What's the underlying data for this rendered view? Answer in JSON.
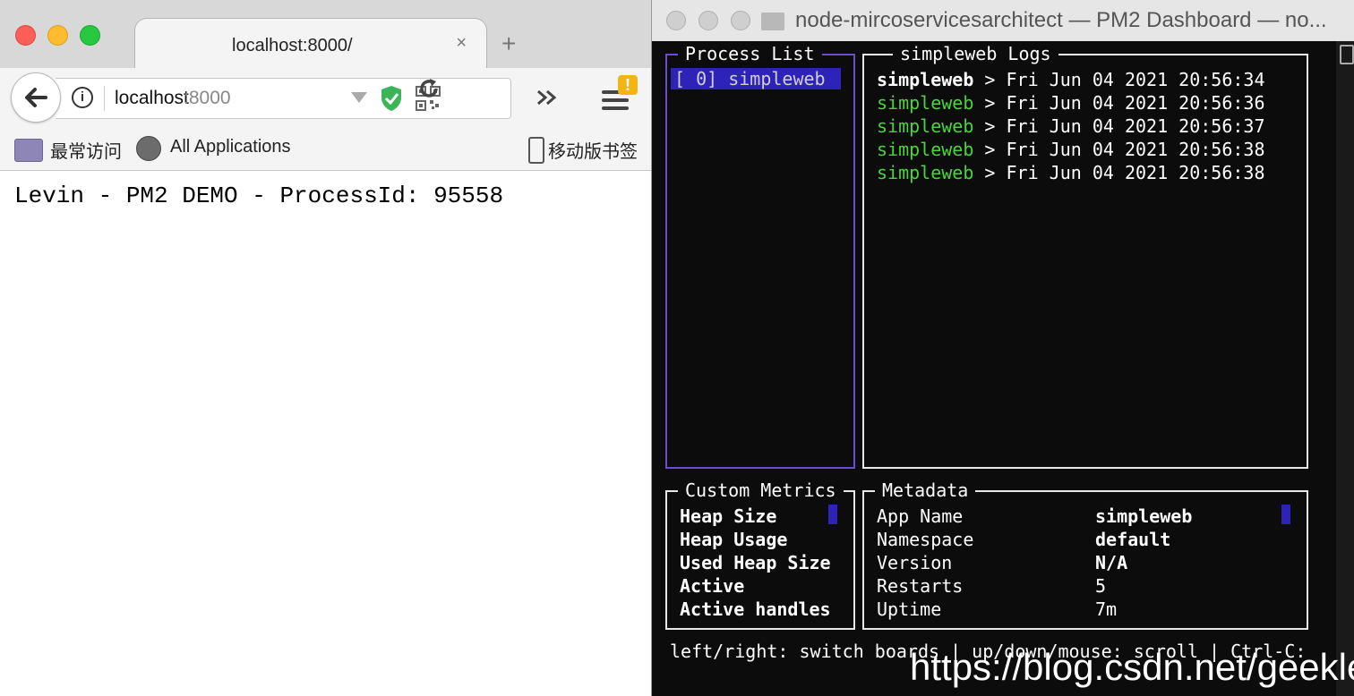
{
  "browser": {
    "tab_title": "localhost:8000/",
    "tab_close": "×",
    "new_tab": "+",
    "url_host": "localhost",
    "url_port": ":8000",
    "bookmarks": [
      "最常访问",
      "All Applications",
      "移动版书签"
    ],
    "page_text": "Levin - PM2 DEMO - ProcessId: 95558",
    "warning_badge": "!"
  },
  "terminal": {
    "window_title": "node-mircoservicesarchitect — PM2 Dashboard — no...",
    "process_list": {
      "label": "Process List",
      "items": [
        "[ 0] simpleweb"
      ]
    },
    "logs": {
      "label": "simpleweb Logs",
      "lines": [
        {
          "app": "simpleweb",
          "text": " > Fri Jun 04 2021 20:56:34"
        },
        {
          "app": "simpleweb",
          "text": " > Fri Jun 04 2021 20:56:36"
        },
        {
          "app": "simpleweb",
          "text": " > Fri Jun 04 2021 20:56:37"
        },
        {
          "app": "simpleweb",
          "text": " > Fri Jun 04 2021 20:56:38"
        },
        {
          "app": "simpleweb",
          "text": " > Fri Jun 04 2021 20:56:38"
        }
      ]
    },
    "custom_metrics": {
      "label": "Custom Metrics",
      "items": [
        "Heap Size",
        "Heap Usage",
        "Used Heap Size",
        "Active",
        "Active handles"
      ]
    },
    "metadata": {
      "label": "Metadata",
      "rows": [
        {
          "key": "App Name",
          "value": "simpleweb"
        },
        {
          "key": "Namespace",
          "value": "default"
        },
        {
          "key": "Version",
          "value": "N/A"
        },
        {
          "key": "Restarts",
          "value": "5"
        },
        {
          "key": "Uptime",
          "value": "7m"
        }
      ]
    },
    "footer_help": "left/right: switch boards | up/down/mouse: scroll | Ctrl-C:",
    "watermark": "https://blog.csdn.net/geeklevi"
  },
  "colors": {
    "log_green": "#4bd33b",
    "selection_blue": "#2e23b8"
  }
}
